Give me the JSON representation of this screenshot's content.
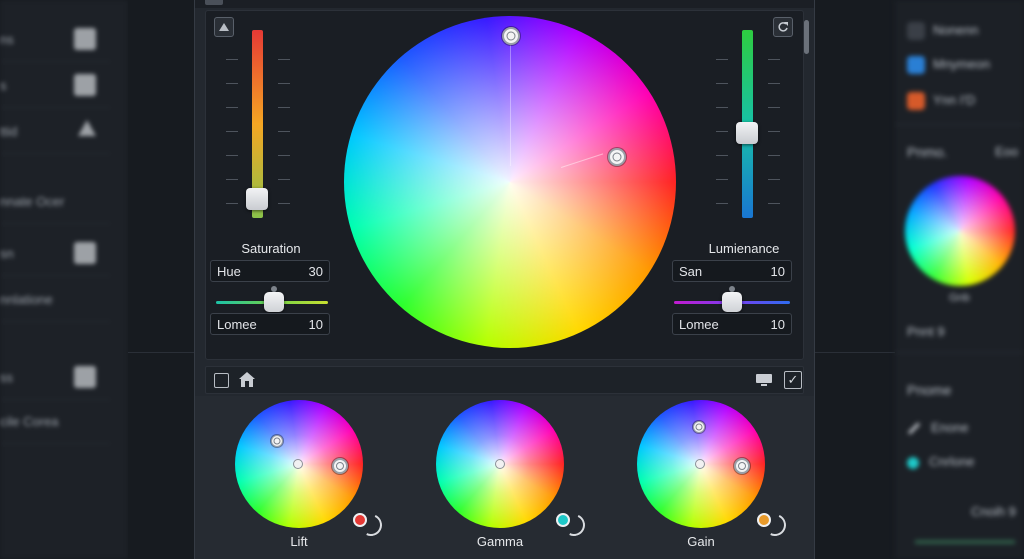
{
  "left_panel": {
    "items": [
      {
        "label": "ns",
        "icon": "pencil-icon"
      },
      {
        "label": "s",
        "icon": "layers-icon"
      },
      {
        "label": "ttid",
        "icon": "triangle-icon"
      },
      {
        "label": "nnate Ocer",
        "icon": ""
      },
      {
        "label": "sn",
        "icon": "panel-icon"
      },
      {
        "label": "nnlatione",
        "icon": ""
      },
      {
        "label": "ss",
        "icon": "copy-icon"
      },
      {
        "label": "cile Corea",
        "icon": ""
      }
    ]
  },
  "dialog": {
    "saturation_label": "Saturation",
    "luminance_label": "Lumienance",
    "hue_field": {
      "key": "Hue",
      "value": "30"
    },
    "left_bottom_field": {
      "key": "Lomee",
      "value": "10"
    },
    "san_field": {
      "key": "San",
      "value": "10"
    },
    "right_bottom_field": {
      "key": "Lomee",
      "value": "10"
    },
    "saturation_level": 0.1,
    "luminance_level": 0.45,
    "hue_slider_level": 0.52,
    "san_slider_level": 0.5,
    "colors": {
      "saturation_gradient_top": "#e53935",
      "saturation_gradient_mid": "#f5a623",
      "saturation_gradient_bottom": "#8bc34a",
      "luminance_gradient_top": "#2ecc40",
      "luminance_gradient_mid": "#17c2a6",
      "luminance_gradient_bottom": "#1976d2"
    }
  },
  "wheels": [
    {
      "label": "Lift",
      "reset_color": "#e53935"
    },
    {
      "label": "Gamma",
      "reset_color": "#1ec8c8"
    },
    {
      "label": "Gain",
      "reset_color": "#e89a2a"
    }
  ],
  "right_panel": {
    "items": [
      {
        "label": "Nonenn"
      },
      {
        "label": "Mnymeon",
        "icon_color": "#2a7fd4"
      },
      {
        "label": "Ynn I'D",
        "icon_color": "#d65a2a"
      }
    ],
    "section1": "Pnmo.",
    "section1_right": "Eoo",
    "wheel_label": "Gnb",
    "row": "Pnnt 9",
    "section2": "Pnome",
    "tool1": "Enone",
    "tool2": "Cnrlone",
    "footer": "Cnoih 9"
  }
}
